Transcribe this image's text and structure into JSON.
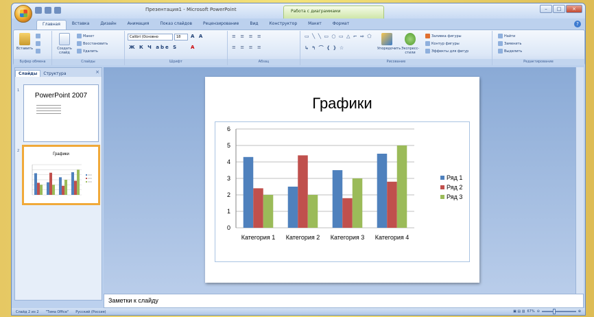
{
  "titlebar": {
    "title": "Презентация1 - Microsoft PowerPoint",
    "context_tab": "Работа с диаграммами"
  },
  "tabs": [
    "Главная",
    "Вставка",
    "Дизайн",
    "Анимация",
    "Показ слайдов",
    "Рецензирование",
    "Вид",
    "Конструктор",
    "Макет",
    "Формат"
  ],
  "ribbon": {
    "clipboard": {
      "paste": "Вставить",
      "label": "Буфер обмена"
    },
    "slides": {
      "create": "Создать слайд",
      "layout": "Макет",
      "reset": "Восстановить",
      "delete": "Удалить",
      "label": "Слайды"
    },
    "font": {
      "name": "Calibri (Основно",
      "size": "18",
      "label": "Шрифт"
    },
    "paragraph": {
      "label": "Абзац"
    },
    "drawing": {
      "arrange": "Упорядочить",
      "quick_styles": "Экспресс-стили",
      "fill": "Заливка фигуры",
      "outline": "Контур фигуры",
      "effects": "Эффекты для фигур",
      "label": "Рисование"
    },
    "editing": {
      "find": "Найти",
      "replace": "Заменить",
      "select": "Выделить",
      "label": "Редактирование"
    }
  },
  "panel": {
    "tab_slides": "Слайды",
    "tab_outline": "Структура",
    "thumb1": {
      "num": "1",
      "title": "PowerPoint 2007"
    },
    "thumb2": {
      "num": "2",
      "title": "Графики"
    }
  },
  "slide": {
    "title": "Графики"
  },
  "chart_data": {
    "type": "bar",
    "categories": [
      "Категория 1",
      "Категория 2",
      "Категория 3",
      "Категория 4"
    ],
    "series": [
      {
        "name": "Ряд 1",
        "values": [
          4.3,
          2.5,
          3.5,
          4.5
        ],
        "color": "#4f81bd"
      },
      {
        "name": "Ряд 2",
        "values": [
          2.4,
          4.4,
          1.8,
          2.8
        ],
        "color": "#c0504d"
      },
      {
        "name": "Ряд 3",
        "values": [
          2,
          2,
          3,
          5
        ],
        "color": "#9bbb59"
      }
    ],
    "ylim": [
      0,
      6
    ],
    "yticks": [
      0,
      1,
      2,
      3,
      4,
      5,
      6
    ],
    "grid": true,
    "legend": "right"
  },
  "notes": {
    "text": "Заметки к слайду"
  },
  "status": {
    "slide": "Слайд 2 из 2",
    "theme": "\"Тема Office\"",
    "lang": "Русский (Россия)",
    "zoom": "67%"
  }
}
